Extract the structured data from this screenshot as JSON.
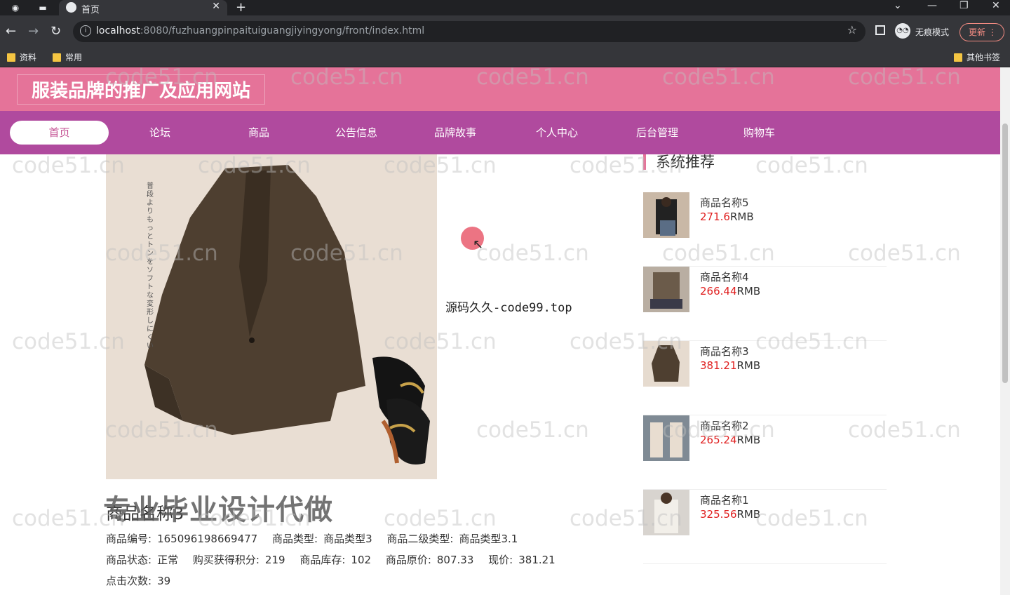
{
  "browser": {
    "tab_title": "首页",
    "url_host": "localhost",
    "url_rest": ":8080/fuzhuangpinpaituiguangjiyingyong/front/index.html",
    "incognito_label": "无痕模式",
    "update_label": "更新",
    "bookmarks": [
      "资料",
      "常用"
    ],
    "other_bookmarks": "其他书签"
  },
  "site": {
    "title": "服装品牌的推广及应用网站",
    "nav": [
      "首页",
      "论坛",
      "商品",
      "公告信息",
      "品牌故事",
      "个人中心",
      "后台管理",
      "购物车"
    ]
  },
  "promo_text": "源码久久-code99.top",
  "overlay_banner": "专业毕业设计代做",
  "product": {
    "name": "商品名称3",
    "image_caption": "普段よりもっとトンをソフトな変形しにくい",
    "fields": [
      [
        [
          "商品编号:",
          "165096198669477"
        ],
        [
          "商品类型:",
          "商品类型3"
        ],
        [
          "商品二级类型:",
          "商品类型3.1"
        ]
      ],
      [
        [
          "商品状态:",
          "正常"
        ],
        [
          "购买获得积分:",
          "219"
        ],
        [
          "商品库存:",
          "102"
        ],
        [
          "商品原价:",
          "807.33"
        ],
        [
          "现价:",
          "381.21"
        ]
      ],
      [
        [
          "点击次数:",
          "39"
        ]
      ]
    ]
  },
  "recommend": {
    "title": "系统推荐",
    "currency": "RMB",
    "items": [
      {
        "name": "商品名称5",
        "price": "271.6"
      },
      {
        "name": "商品名称4",
        "price": "266.44"
      },
      {
        "name": "商品名称3",
        "price": "381.21"
      },
      {
        "name": "商品名称2",
        "price": "265.24"
      },
      {
        "name": "商品名称1",
        "price": "325.56"
      }
    ]
  },
  "watermark": "code51.cn",
  "colors": {
    "header": "#e57399",
    "navbar": "#b04a9e",
    "price": "#e02020"
  }
}
